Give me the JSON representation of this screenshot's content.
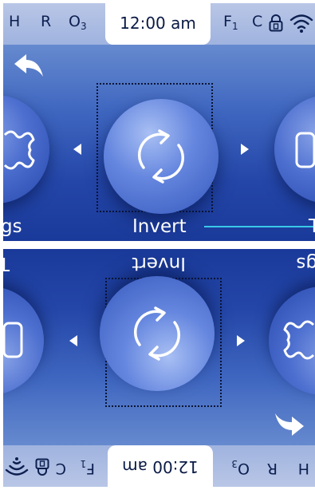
{
  "status_bar": {
    "indicators": {
      "h": "H",
      "r": "R",
      "o3": "O",
      "o3_sub": "3",
      "f1": "F",
      "f1_sub": "1",
      "c": "C"
    },
    "time": "12:00 am",
    "icons": [
      "lock-icon",
      "wifi-icon"
    ]
  },
  "navigation": {
    "back_icon": "back-arrow-icon",
    "prev_icon": "triangle-left-icon",
    "next_icon": "triangle-right-icon"
  },
  "carousel": {
    "left_label": "ings",
    "center_label": "Invert",
    "right_label": "T",
    "center_icon": "invert-rotate-icon",
    "left_icon": "settings-gear-icon",
    "right_icon": "tile-icon"
  },
  "colors": {
    "accent_underline": "#39c8e8",
    "background_top": "#7fa0d8",
    "background_bottom": "#1a3a9a",
    "status_bar": "#b9c6e6",
    "time_box": "#ffffff"
  }
}
